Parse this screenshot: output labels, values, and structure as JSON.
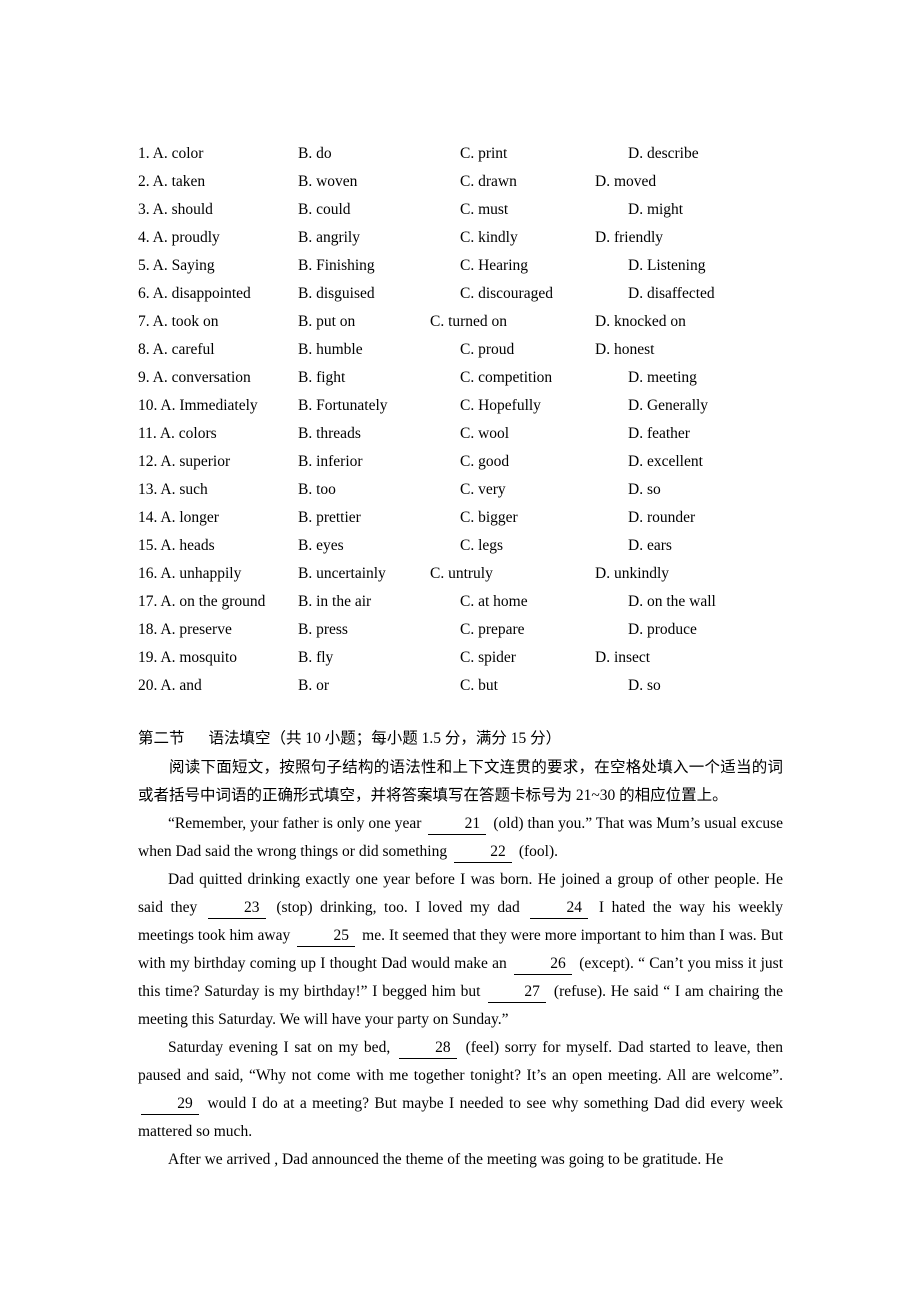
{
  "document": {
    "cloze_section": {
      "columns": [
        "A",
        "B",
        "C",
        "D"
      ],
      "rows": [
        {
          "num": "1.",
          "a": "A. color",
          "b": "B. do",
          "c": "C. print",
          "d": "D. describe",
          "c_narrow": false,
          "d_narrow": false
        },
        {
          "num": "2.",
          "a": "A. taken",
          "b": "B. woven",
          "c": "C. drawn",
          "d": "D. moved",
          "c_narrow": false,
          "d_narrow": true
        },
        {
          "num": "3.",
          "a": "A. should",
          "b": "B. could",
          "c": "C. must",
          "d": "D. might",
          "c_narrow": false,
          "d_narrow": false
        },
        {
          "num": "4.",
          "a": "A. proudly",
          "b": "B. angrily",
          "c": "C. kindly",
          "d": "D. friendly",
          "c_narrow": false,
          "d_narrow": true
        },
        {
          "num": "5.",
          "a": "A. Saying",
          "b": "B. Finishing",
          "c": "C. Hearing",
          "d": "D. Listening",
          "c_narrow": false,
          "d_narrow": false
        },
        {
          "num": "6.",
          "a": "A. disappointed",
          "b": "B. disguised",
          "c": "C. discouraged",
          "d": "D. disaffected",
          "c_narrow": false,
          "d_narrow": false
        },
        {
          "num": "7.",
          "a": "A. took on",
          "b": "B. put on",
          "c": "C. turned on",
          "d": "D. knocked on",
          "c_narrow": true,
          "d_narrow": true
        },
        {
          "num": "8.",
          "a": "A. careful",
          "b": "B. humble",
          "c": "C. proud",
          "d": "D. honest",
          "c_narrow": false,
          "d_narrow": true
        },
        {
          "num": "9.",
          "a": "A. conversation",
          "b": "B. fight",
          "c": "C. competition",
          "d": "D. meeting",
          "c_narrow": false,
          "d_narrow": false
        },
        {
          "num": "10.",
          "a": "A. Immediately",
          "b": "B. Fortunately",
          "c": "C. Hopefully",
          "d": "D. Generally",
          "c_narrow": false,
          "d_narrow": false
        },
        {
          "num": "11.",
          "a": "A. colors",
          "b": "B. threads",
          "c": "C. wool",
          "d": "D. feather",
          "c_narrow": false,
          "d_narrow": false
        },
        {
          "num": "12.",
          "a": "A. superior",
          "b": "B. inferior",
          "c": "C. good",
          "d": "D. excellent",
          "c_narrow": false,
          "d_narrow": false
        },
        {
          "num": "13.",
          "a": "A. such",
          "b": "B. too",
          "c": "C. very",
          "d": "D. so",
          "c_narrow": false,
          "d_narrow": false
        },
        {
          "num": "14.",
          "a": "A. longer",
          "b": "B. prettier",
          "c": "C. bigger",
          "d": "D. rounder",
          "c_narrow": false,
          "d_narrow": false
        },
        {
          "num": "15.",
          "a": "A. heads",
          "b": "B. eyes",
          "c": "C. legs",
          "d": "D. ears",
          "c_narrow": false,
          "d_narrow": false
        },
        {
          "num": "16.",
          "a": "A. unhappily",
          "b": "B. uncertainly",
          "c": "C. untruly",
          "d": "D. unkindly",
          "c_narrow": true,
          "d_narrow": true
        },
        {
          "num": "17.",
          "a": "A. on the ground",
          "b": "B. in the air",
          "c": "C. at home",
          "d": "D. on the wall",
          "c_narrow": false,
          "d_narrow": false
        },
        {
          "num": "18.",
          "a": "A. preserve",
          "b": "B. press",
          "c": "C. prepare",
          "d": "D. produce",
          "c_narrow": false,
          "d_narrow": false
        },
        {
          "num": "19.",
          "a": "A. mosquito",
          "b": "B. fly",
          "c": "C. spider",
          "d": "D. insect",
          "c_narrow": false,
          "d_narrow": true
        },
        {
          "num": "20.",
          "a": "A. and",
          "b": "B. or",
          "c": "C. but",
          "d": "D. so",
          "c_narrow": false,
          "d_narrow": false
        }
      ]
    },
    "section_two": {
      "label": "第二节",
      "title": "语法填空（共 10 小题；每小题 1.5 分，满分 15 分）",
      "instruction": "阅读下面短文，按照句子结构的语法性和上下文连贯的要求，在空格处填入一个适当的词或者括号中词语的正确形式填空，并将答案填写在答题卡标号为 21~30 的相应位置上。"
    },
    "passage": {
      "p1": {
        "t1": "“Remember, your father is only one year",
        "blank1": "21",
        "t2": "(old) than you.” That was Mum’s usual excuse when Dad said the wrong things or did something",
        "blank2": "22",
        "t3": "(fool)."
      },
      "p2": {
        "t1": "Dad quitted drinking exactly one year before I was born. He joined a group of other people. He said they",
        "blank1": "23",
        "t2": "(stop) drinking, too. I loved my dad",
        "blank2": "24",
        "t3": "I hated the way his weekly meetings took him away",
        "blank3": "25",
        "t4": "me. It seemed that they were more important to him than I was. But with my birthday coming up I thought Dad would make an",
        "blank4": "26",
        "t5": "(except). “ Can’t you miss it just this time? Saturday is my birthday!” I begged him but",
        "blank5": "27",
        "t6": "(refuse). He said “ I am chairing the meeting this Saturday. We will have your party on Sunday.”"
      },
      "p3": {
        "t1": "Saturday evening I sat on my bed,",
        "blank1": "28",
        "t2": "(feel) sorry for myself. Dad started to leave, then paused and said, “Why not come with me together tonight? It’s an open meeting. All are welcome”.",
        "blank2": "29",
        "t3": "would I do at a meeting? But maybe I needed to see why something Dad did every week mattered so much."
      },
      "p4": {
        "t1": "After we arrived , Dad announced the theme of the meeting was going to be gratitude. He"
      }
    }
  }
}
